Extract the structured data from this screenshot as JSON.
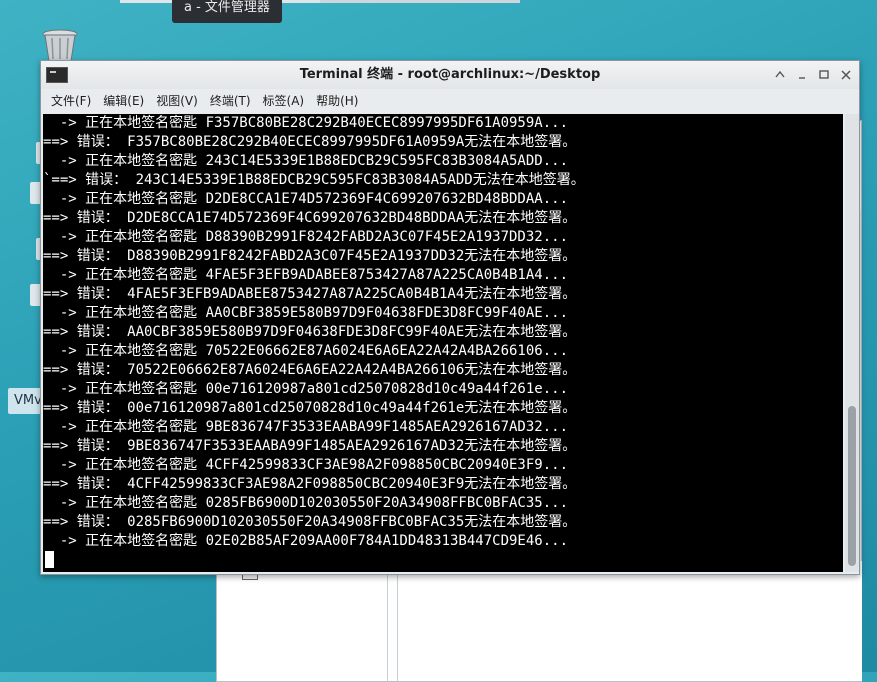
{
  "tooltip": {
    "text": "a - 文件管理器"
  },
  "desktop": {
    "vmware_fragment": "VMv"
  },
  "terminal": {
    "title": "Terminal 终端 - root@archlinux:~/Desktop",
    "menu": [
      "文件(F)",
      "编辑(E)",
      "视图(V)",
      "终端(T)",
      "标签(A)",
      "帮助(H)"
    ],
    "lines": [
      "  -> 正在本地签名密匙 F357BC80BE28C292B40ECEC8997995DF61A0959A...",
      "==> 错误： F357BC80BE28C292B40ECEC8997995DF61A0959A无法在本地签署。",
      "  -> 正在本地签名密匙 243C14E5339E1B88EDCB29C595FC83B3084A5ADD...",
      "`==> 错误： 243C14E5339E1B88EDCB29C595FC83B3084A5ADD无法在本地签署。",
      "  -> 正在本地签名密匙 D2DE8CCA1E74D572369F4C699207632BD48BDDAA...",
      "==> 错误： D2DE8CCA1E74D572369F4C699207632BD48BDDAA无法在本地签署。",
      "  -> 正在本地签名密匙 D88390B2991F8242FABD2A3C07F45E2A1937DD32...",
      "==> 错误： D88390B2991F8242FABD2A3C07F45E2A1937DD32无法在本地签署。",
      "  -> 正在本地签名密匙 4FAE5F3EFB9ADABEE8753427A87A225CA0B4B1A4...",
      "==> 错误： 4FAE5F3EFB9ADABEE8753427A87A225CA0B4B1A4无法在本地签署。",
      "  -> 正在本地签名密匙 AA0CBF3859E580B97D9F04638FDE3D8FC99F40AE...",
      "==> 错误： AA0CBF3859E580B97D9F04638FDE3D8FC99F40AE无法在本地签署。",
      "  -> 正在本地签名密匙 70522E06662E87A6024E6A6EA22A42A4BA266106...",
      "==> 错误： 70522E06662E87A6024E6A6EA22A42A4BA266106无法在本地签署。",
      "  -> 正在本地签名密匙 00e716120987a801cd25070828d10c49a44f261e...",
      "==> 错误： 00e716120987a801cd25070828d10c49a44f261e无法在本地签署。",
      "  -> 正在本地签名密匙 9BE836747F3533EAABA99F1485AEA2926167AD32...",
      "==> 错误： 9BE836747F3533EAABA99F1485AEA2926167AD32无法在本地签署。",
      "  -> 正在本地签名密匙 4CFF42599833CF3AE98A2F098850CBC20940E3F9...",
      "==> 错误： 4CFF42599833CF3AE98A2F098850CBC20940E3F9无法在本地签署。",
      "  -> 正在本地签名密匙 0285FB6900D102030550F20A34908FFBC0BFAC35...",
      "==> 错误： 0285FB6900D102030550F20A34908FFBC0BFAC35无法在本地签署。",
      "  -> 正在本地签名密匙 02E02B85AF209AA00F784A1DD48313B447CD9E46..."
    ]
  },
  "icons": {
    "terminal": "terminal-icon",
    "trash": "trash-icon",
    "shade": "shade-icon",
    "minimize": "minimize-icon",
    "maximize": "maximize-icon",
    "close": "close-icon"
  }
}
